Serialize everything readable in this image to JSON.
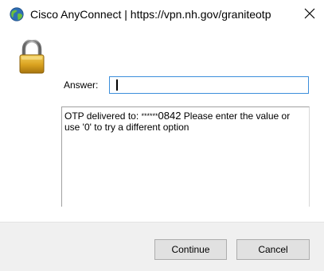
{
  "window": {
    "title": "Cisco AnyConnect | https://vpn.nh.gov/graniteotp"
  },
  "icons": {
    "app": "cisco-anyconnect-globe-icon",
    "close": "close-icon",
    "lock": "padlock-icon"
  },
  "form": {
    "answer_label": "Answer:",
    "answer_value": ""
  },
  "message": {
    "prefix": "OTP delivered to: ",
    "masked": "******",
    "last4": "0842",
    "suffix": " Please enter the value or use '0' to try a different option"
  },
  "buttons": {
    "continue": "Continue",
    "cancel": "Cancel"
  },
  "colors": {
    "input_focus_border": "#3c8edb",
    "footer_bg": "#f0f0f0",
    "button_bg": "#e1e1e1",
    "button_border": "#adadad"
  }
}
